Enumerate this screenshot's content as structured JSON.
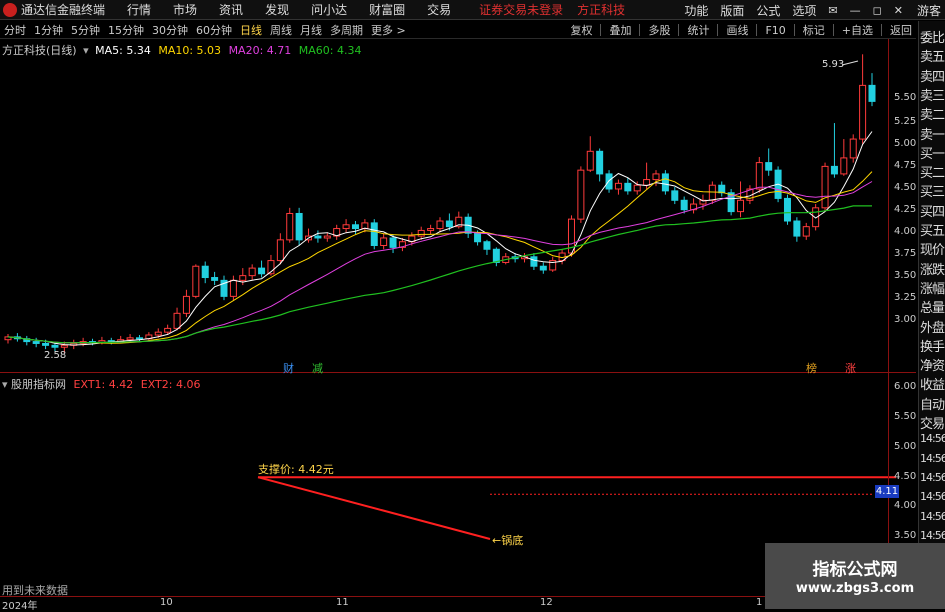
{
  "menubar": {
    "app_name": "通达信金融终端",
    "items": [
      "行情",
      "市场",
      "资讯",
      "发现",
      "问小达",
      "财富圈",
      "交易"
    ],
    "warning": "证券交易未登录",
    "stock_name": "方正科技",
    "right_items": [
      "功能",
      "版面",
      "公式",
      "选项"
    ],
    "user": "游客"
  },
  "periodbar": {
    "periods": [
      "分时",
      "1分钟",
      "5分钟",
      "15分钟",
      "30分钟",
      "60分钟",
      "日线",
      "周线",
      "月线",
      "多周期",
      "更多 >"
    ],
    "active": "日线",
    "right_items": [
      "复权",
      "叠加",
      "多股",
      "统计",
      "画线",
      "F10",
      "标记",
      "+自选",
      "返回"
    ]
  },
  "chart_title": {
    "name": "方正科技(日线)",
    "ma5": "MA5: 5.34",
    "ma10": "MA10: 5.03",
    "ma20": "MA20: 4.71",
    "ma60": "MA60: 4.34",
    "colors": {
      "ma5": "#ffffff",
      "ma10": "#ffd700",
      "ma20": "#e040e0",
      "ma60": "#20c020"
    }
  },
  "indicator_title": {
    "name": "股朋指标网",
    "ext1": "EXT1: 4.42",
    "ext2": "EXT2: 4.06"
  },
  "right_panel": [
    "委比",
    "卖五",
    "卖四",
    "卖三",
    "卖二",
    "卖一",
    "买一",
    "买二",
    "买三",
    "买四",
    "买五",
    "现价",
    "涨跌",
    "涨幅",
    "总量",
    "外盘",
    "换手",
    "净资",
    "收益",
    "自动",
    "交易",
    "14:56",
    "14:56",
    "14:56",
    "14:56",
    "14:56",
    "14:56",
    "14:56",
    "14:56"
  ],
  "main_yaxis": [
    "5.50",
    "5.25",
    "5.00",
    "4.75",
    "4.50",
    "4.25",
    "4.00",
    "3.75",
    "3.50",
    "3.25",
    "3.00"
  ],
  "sub_yaxis": [
    "6.00",
    "5.50",
    "5.00",
    "4.50",
    "4.00",
    "3.50"
  ],
  "xaxis": [
    "2024年",
    "10",
    "11",
    "12",
    "1"
  ],
  "annotations": {
    "high": "5.93",
    "low": "2.58",
    "event1": "财",
    "event2": "减",
    "event3": "榜",
    "event4": "涨",
    "support": "支撑价: 4.42元",
    "bottom": "←锅底",
    "price_tag": "4.11"
  },
  "footer_text": "用到未来数据",
  "watermark": {
    "line1": "指标公式网",
    "line2": "www.zbgs3.com"
  },
  "chart_data": {
    "type": "candlestick",
    "title": "方正科技(日线)",
    "ylim": [
      2.8,
      5.9
    ],
    "candles": [
      [
        2.92,
        2.95,
        2.98,
        2.88
      ],
      [
        2.95,
        2.93,
        2.99,
        2.9
      ],
      [
        2.93,
        2.9,
        2.96,
        2.86
      ],
      [
        2.9,
        2.88,
        2.94,
        2.84
      ],
      [
        2.88,
        2.86,
        2.92,
        2.82
      ],
      [
        2.86,
        2.84,
        2.9,
        2.8
      ],
      [
        2.84,
        2.86,
        2.9,
        2.78
      ],
      [
        2.86,
        2.88,
        2.92,
        2.82
      ],
      [
        2.88,
        2.9,
        2.94,
        2.85
      ],
      [
        2.9,
        2.89,
        2.93,
        2.86
      ],
      [
        2.89,
        2.91,
        2.95,
        2.87
      ],
      [
        2.91,
        2.9,
        2.94,
        2.87
      ],
      [
        2.9,
        2.92,
        2.96,
        2.88
      ],
      [
        2.92,
        2.94,
        2.98,
        2.89
      ],
      [
        2.94,
        2.93,
        2.97,
        2.9
      ],
      [
        2.93,
        2.97,
        3.0,
        2.9
      ],
      [
        2.97,
        3.0,
        3.04,
        2.94
      ],
      [
        3.0,
        3.04,
        3.08,
        2.97
      ],
      [
        3.04,
        3.2,
        3.26,
        3.02
      ],
      [
        3.2,
        3.38,
        3.45,
        3.16
      ],
      [
        3.38,
        3.7,
        3.72,
        3.36
      ],
      [
        3.7,
        3.58,
        3.75,
        3.52
      ],
      [
        3.58,
        3.55,
        3.64,
        3.5
      ],
      [
        3.55,
        3.38,
        3.6,
        3.34
      ],
      [
        3.38,
        3.55,
        3.6,
        3.34
      ],
      [
        3.55,
        3.6,
        3.68,
        3.5
      ],
      [
        3.6,
        3.68,
        3.72,
        3.55
      ],
      [
        3.68,
        3.62,
        3.76,
        3.58
      ],
      [
        3.62,
        3.76,
        3.82,
        3.6
      ],
      [
        3.76,
        3.98,
        4.05,
        3.72
      ],
      [
        3.98,
        4.26,
        4.32,
        3.95
      ],
      [
        4.26,
        3.98,
        4.32,
        3.92
      ],
      [
        3.98,
        4.02,
        4.1,
        3.95
      ],
      [
        4.02,
        4.0,
        4.08,
        3.95
      ],
      [
        4.0,
        4.02,
        4.06,
        3.96
      ],
      [
        4.02,
        4.1,
        4.14,
        3.98
      ],
      [
        4.1,
        4.14,
        4.2,
        4.06
      ],
      [
        4.14,
        4.1,
        4.18,
        4.04
      ],
      [
        4.1,
        4.16,
        4.2,
        4.06
      ],
      [
        4.16,
        3.92,
        4.2,
        3.88
      ],
      [
        3.92,
        4.0,
        4.05,
        3.88
      ],
      [
        4.0,
        3.9,
        4.04,
        3.84
      ],
      [
        3.9,
        3.96,
        4.0,
        3.86
      ],
      [
        3.96,
        4.02,
        4.06,
        3.92
      ],
      [
        4.02,
        4.08,
        4.12,
        3.98
      ],
      [
        4.08,
        4.1,
        4.14,
        4.04
      ],
      [
        4.1,
        4.18,
        4.22,
        4.06
      ],
      [
        4.18,
        4.12,
        4.26,
        4.08
      ],
      [
        4.12,
        4.22,
        4.28,
        4.1
      ],
      [
        4.22,
        4.05,
        4.26,
        4.0
      ],
      [
        4.05,
        3.96,
        4.08,
        3.92
      ],
      [
        3.96,
        3.88,
        3.98,
        3.82
      ],
      [
        3.88,
        3.74,
        3.9,
        3.7
      ],
      [
        3.74,
        3.8,
        3.84,
        3.72
      ],
      [
        3.8,
        3.78,
        3.84,
        3.74
      ],
      [
        3.78,
        3.8,
        3.84,
        3.74
      ],
      [
        3.8,
        3.7,
        3.84,
        3.66
      ],
      [
        3.7,
        3.66,
        3.74,
        3.62
      ],
      [
        3.66,
        3.76,
        3.8,
        3.64
      ],
      [
        3.76,
        3.84,
        3.88,
        3.72
      ],
      [
        3.84,
        4.2,
        4.24,
        3.8
      ],
      [
        4.2,
        4.72,
        4.76,
        4.16
      ],
      [
        4.72,
        4.92,
        5.08,
        4.7
      ],
      [
        4.92,
        4.68,
        4.95,
        4.6
      ],
      [
        4.68,
        4.52,
        4.72,
        4.48
      ],
      [
        4.52,
        4.58,
        4.62,
        4.46
      ],
      [
        4.58,
        4.5,
        4.64,
        4.46
      ],
      [
        4.5,
        4.56,
        4.6,
        4.46
      ],
      [
        4.56,
        4.62,
        4.8,
        4.52
      ],
      [
        4.62,
        4.68,
        4.72,
        4.55
      ],
      [
        4.68,
        4.5,
        4.72,
        4.46
      ],
      [
        4.5,
        4.4,
        4.54,
        4.36
      ],
      [
        4.4,
        4.3,
        4.44,
        4.26
      ],
      [
        4.3,
        4.36,
        4.42,
        4.26
      ],
      [
        4.36,
        4.4,
        4.46,
        4.3
      ],
      [
        4.4,
        4.56,
        4.6,
        4.36
      ],
      [
        4.56,
        4.48,
        4.6,
        4.44
      ],
      [
        4.48,
        4.28,
        4.52,
        4.24
      ],
      [
        4.28,
        4.4,
        4.6,
        4.22
      ],
      [
        4.4,
        4.52,
        4.56,
        4.36
      ],
      [
        4.52,
        4.8,
        4.86,
        4.48
      ],
      [
        4.8,
        4.72,
        4.95,
        4.66
      ],
      [
        4.72,
        4.42,
        4.76,
        4.38
      ],
      [
        4.42,
        4.18,
        4.46,
        4.14
      ],
      [
        4.18,
        4.02,
        4.22,
        3.96
      ],
      [
        4.02,
        4.12,
        4.16,
        3.98
      ],
      [
        4.12,
        4.32,
        4.36,
        4.08
      ],
      [
        4.32,
        4.76,
        4.8,
        4.28
      ],
      [
        4.76,
        4.68,
        5.22,
        4.64
      ],
      [
        4.68,
        4.85,
        5.05,
        4.66
      ],
      [
        4.85,
        5.05,
        5.1,
        4.8
      ],
      [
        5.05,
        5.62,
        5.95,
        5.0
      ],
      [
        5.62,
        5.45,
        5.75,
        5.4
      ]
    ],
    "support_price": 4.42,
    "sub_ylim": [
      3.3,
      6.2
    ]
  }
}
